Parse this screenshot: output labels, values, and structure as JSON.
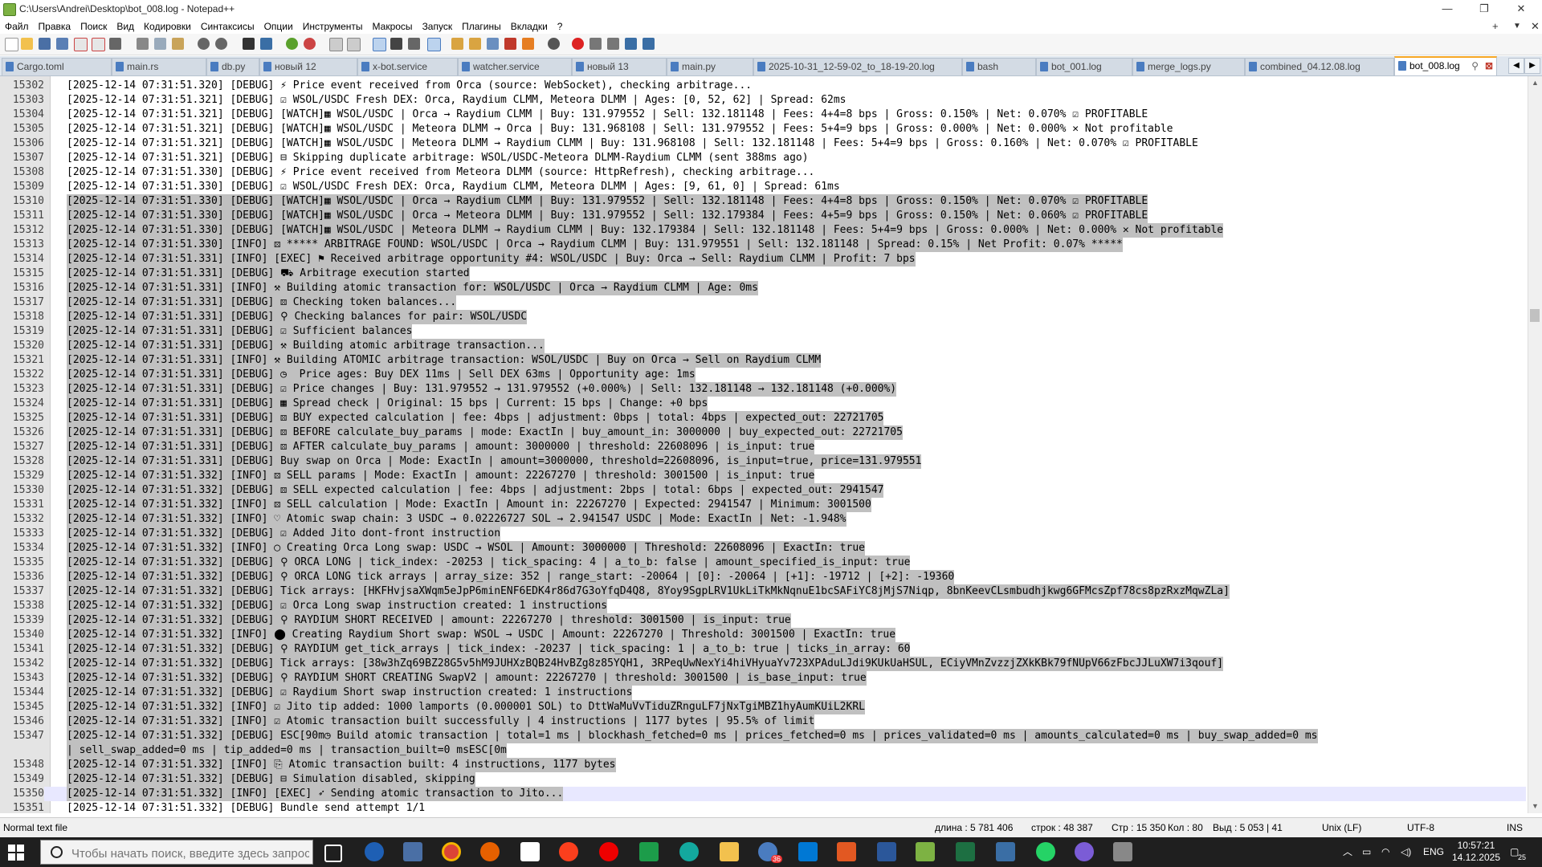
{
  "window": {
    "title": "C:\\Users\\Andrei\\Desktop\\bot_008.log - Notepad++",
    "minimize": "—",
    "maximize": "❐",
    "close": "✕"
  },
  "menu": {
    "items": [
      "Файл",
      "Правка",
      "Поиск",
      "Вид",
      "Кодировки",
      "Синтаксисы",
      "Опции",
      "Инструменты",
      "Макросы",
      "Запуск",
      "Плагины",
      "Вкладки",
      "?"
    ],
    "plus": "+",
    "dropdown": "▼",
    "x": "✕"
  },
  "tabs": [
    {
      "label": "Cargo.toml"
    },
    {
      "label": "main.rs"
    },
    {
      "label": "db.py"
    },
    {
      "label": "новый 12"
    },
    {
      "label": "x-bot.service"
    },
    {
      "label": "watcher.service"
    },
    {
      "label": "новый 13"
    },
    {
      "label": "main.py"
    },
    {
      "label": "2025-10-31_12-59-02_to_18-19-20.log"
    },
    {
      "label": "bash"
    },
    {
      "label": "bot_001.log"
    },
    {
      "label": "merge_logs.py"
    },
    {
      "label": "combined_04.12.08.log"
    },
    {
      "label": "bot_008.log"
    }
  ],
  "tabnav": {
    "left": "◀",
    "right": "▶"
  },
  "lines": [
    {
      "n": "15302",
      "t": "[2025-12-14 07:31:51.320] [DEBUG] ⚡ Price event received from Orca (source: WebSocket), checking arbitrage...",
      "s": false
    },
    {
      "n": "15303",
      "t": "[2025-12-14 07:31:51.321] [DEBUG] ☑ WSOL/USDC Fresh DEX: Orca, Raydium CLMM, Meteora DLMM | Ages: [0, 52, 62] | Spread: 62ms",
      "s": false
    },
    {
      "n": "15304",
      "t": "[2025-12-14 07:31:51.321] [DEBUG] [WATCH]▦ WSOL/USDC | Orca → Raydium CLMM | Buy: 131.979552 | Sell: 132.181148 | Fees: 4+4=8 bps | Gross: 0.150% | Net: 0.070% ☑ PROFITABLE",
      "s": false
    },
    {
      "n": "15305",
      "t": "[2025-12-14 07:31:51.321] [DEBUG] [WATCH]▦ WSOL/USDC | Meteora DLMM → Orca | Buy: 131.968108 | Sell: 131.979552 | Fees: 5+4=9 bps | Gross: 0.000% | Net: 0.000% ✕ Not profitable",
      "s": false
    },
    {
      "n": "15306",
      "t": "[2025-12-14 07:31:51.321] [DEBUG] [WATCH]▦ WSOL/USDC | Meteora DLMM → Raydium CLMM | Buy: 131.968108 | Sell: 132.181148 | Fees: 5+4=9 bps | Gross: 0.160% | Net: 0.070% ☑ PROFITABLE",
      "s": false
    },
    {
      "n": "15307",
      "t": "[2025-12-14 07:31:51.321] [DEBUG] ⊟ Skipping duplicate arbitrage: WSOL/USDC-Meteora DLMM-Raydium CLMM (sent 388ms ago)",
      "s": false
    },
    {
      "n": "15308",
      "t": "[2025-12-14 07:31:51.330] [DEBUG] ⚡ Price event received from Meteora DLMM (source: HttpRefresh), checking arbitrage...",
      "s": false
    },
    {
      "n": "15309",
      "t": "[2025-12-14 07:31:51.330] [DEBUG] ☑ WSOL/USDC Fresh DEX: Orca, Raydium CLMM, Meteora DLMM | Ages: [9, 61, 0] | Spread: 61ms",
      "s": false
    },
    {
      "n": "15310",
      "t": "[2025-12-14 07:31:51.330] [DEBUG] [WATCH]▦ WSOL/USDC | Orca → Raydium CLMM | Buy: 131.979552 | Sell: 132.181148 | Fees: 4+4=8 bps | Gross: 0.150% | Net: 0.070% ☑ PROFITABLE",
      "s": true
    },
    {
      "n": "15311",
      "t": "[2025-12-14 07:31:51.330] [DEBUG] [WATCH]▦ WSOL/USDC | Orca → Meteora DLMM | Buy: 131.979552 | Sell: 132.179384 | Fees: 4+5=9 bps | Gross: 0.150% | Net: 0.060% ☑ PROFITABLE",
      "s": true
    },
    {
      "n": "15312",
      "t": "[2025-12-14 07:31:51.330] [DEBUG] [WATCH]▦ WSOL/USDC | Meteora DLMM → Raydium CLMM | Buy: 132.179384 | Sell: 132.181148 | Fees: 5+4=9 bps | Gross: 0.000% | Net: 0.000% ✕ Not profitable",
      "s": true
    },
    {
      "n": "15313",
      "t": "[2025-12-14 07:31:51.330] [INFO] ⚄ ***** ARBITRAGE FOUND: WSOL/USDC | Orca → Raydium CLMM | Buy: 131.979551 | Sell: 132.181148 | Spread: 0.15% | Net Profit: 0.07% *****",
      "s": true
    },
    {
      "n": "15314",
      "t": "[2025-12-14 07:31:51.331] [INFO] [EXEC] ⚑ Received arbitrage opportunity #4: WSOL/USDC | Buy: Orca → Sell: Raydium CLMM | Profit: 7 bps",
      "s": true
    },
    {
      "n": "15315",
      "t": "[2025-12-14 07:31:51.331] [DEBUG] ⛟ Arbitrage execution started",
      "s": true
    },
    {
      "n": "15316",
      "t": "[2025-12-14 07:31:51.331] [INFO] ⚒ Building atomic transaction for: WSOL/USDC | Orca → Raydium CLMM | Age: 0ms",
      "s": true
    },
    {
      "n": "15317",
      "t": "[2025-12-14 07:31:51.331] [DEBUG] ⚄ Checking token balances...",
      "s": true
    },
    {
      "n": "15318",
      "t": "[2025-12-14 07:31:51.331] [DEBUG] ⚲ Checking balances for pair: WSOL/USDC",
      "s": true
    },
    {
      "n": "15319",
      "t": "[2025-12-14 07:31:51.331] [DEBUG] ☑ Sufficient balances",
      "s": true
    },
    {
      "n": "15320",
      "t": "[2025-12-14 07:31:51.331] [DEBUG] ⚒ Building atomic arbitrage transaction...",
      "s": true
    },
    {
      "n": "15321",
      "t": "[2025-12-14 07:31:51.331] [INFO] ⚒ Building ATOMIC arbitrage transaction: WSOL/USDC | Buy on Orca → Sell on Raydium CLMM",
      "s": true
    },
    {
      "n": "15322",
      "t": "[2025-12-14 07:31:51.331] [DEBUG] ◷  Price ages: Buy DEX 11ms | Sell DEX 63ms | Opportunity age: 1ms",
      "s": true
    },
    {
      "n": "15323",
      "t": "[2025-12-14 07:31:51.331] [DEBUG] ☑ Price changes | Buy: 131.979552 → 131.979552 (+0.000%) | Sell: 132.181148 → 132.181148 (+0.000%)",
      "s": true
    },
    {
      "n": "15324",
      "t": "[2025-12-14 07:31:51.331] [DEBUG] ▦ Spread check | Original: 15 bps | Current: 15 bps | Change: +0 bps",
      "s": true
    },
    {
      "n": "15325",
      "t": "[2025-12-14 07:31:51.331] [DEBUG] ⚄ BUY expected calculation | fee: 4bps | adjustment: 0bps | total: 4bps | expected_out: 22721705",
      "s": true
    },
    {
      "n": "15326",
      "t": "[2025-12-14 07:31:51.331] [DEBUG] ⚄ BEFORE calculate_buy_params | mode: ExactIn | buy_amount_in: 3000000 | buy_expected_out: 22721705",
      "s": true
    },
    {
      "n": "15327",
      "t": "[2025-12-14 07:31:51.331] [DEBUG] ⚄ AFTER calculate_buy_params | amount: 3000000 | threshold: 22608096 | is_input: true",
      "s": true
    },
    {
      "n": "15328",
      "t": "[2025-12-14 07:31:51.331] [DEBUG] Buy swap on Orca | Mode: ExactIn | amount=3000000, threshold=22608096, is_input=true, price=131.979551",
      "s": true
    },
    {
      "n": "15329",
      "t": "[2025-12-14 07:31:51.332] [INFO] ⚄ SELL params | Mode: ExactIn | amount: 22267270 | threshold: 3001500 | is_input: true",
      "s": true
    },
    {
      "n": "15330",
      "t": "[2025-12-14 07:31:51.332] [DEBUG] ⚄ SELL expected calculation | fee: 4bps | adjustment: 2bps | total: 6bps | expected_out: 2941547",
      "s": true
    },
    {
      "n": "15331",
      "t": "[2025-12-14 07:31:51.332] [INFO] ⚄ SELL calculation | Mode: ExactIn | Amount in: 22267270 | Expected: 2941547 | Minimum: 3001500",
      "s": true
    },
    {
      "n": "15332",
      "t": "[2025-12-14 07:31:51.332] [INFO] ♡ Atomic swap chain: 3 USDC → 0.02226727 SOL → 2.941547 USDC | Mode: ExactIn | Net: -1.948%",
      "s": true
    },
    {
      "n": "15333",
      "t": "[2025-12-14 07:31:51.332] [DEBUG] ☑ Added Jito dont-front instruction",
      "s": true
    },
    {
      "n": "15334",
      "t": "[2025-12-14 07:31:51.332] [INFO] ◯ Creating Orca Long swap: USDC → WSOL | Amount: 3000000 | Threshold: 22608096 | ExactIn: true",
      "s": true
    },
    {
      "n": "15335",
      "t": "[2025-12-14 07:31:51.332] [DEBUG] ⚲ ORCA LONG | tick_index: -20253 | tick_spacing: 4 | a_to_b: false | amount_specified_is_input: true",
      "s": true
    },
    {
      "n": "15336",
      "t": "[2025-12-14 07:31:51.332] [DEBUG] ⚲ ORCA LONG tick arrays | array_size: 352 | range_start: -20064 | [0]: -20064 | [+1]: -19712 | [+2]: -19360",
      "s": true
    },
    {
      "n": "15337",
      "t": "[2025-12-14 07:31:51.332] [DEBUG] Tick arrays: [HKFHvjsaXWqm5eJpP6minENF6EDK4r86d7G3oYfqD4Q8, 8Yoy9SgpLRV1UkLiTkMkNqnuE1bcSAFiYC8jMjS7Niqp, 8bnKeevCLsmbudhjkwg6GFMcsZpf78cs8pzRxzMqwZLa]",
      "s": true
    },
    {
      "n": "15338",
      "t": "[2025-12-14 07:31:51.332] [DEBUG] ☑ Orca Long swap instruction created: 1 instructions",
      "s": true
    },
    {
      "n": "15339",
      "t": "[2025-12-14 07:31:51.332] [DEBUG] ⚲ RAYDIUM SHORT RECEIVED | amount: 22267270 | threshold: 3001500 | is_input: true",
      "s": true
    },
    {
      "n": "15340",
      "t": "[2025-12-14 07:31:51.332] [INFO] ⬤ Creating Raydium Short swap: WSOL → USDC | Amount: 22267270 | Threshold: 3001500 | ExactIn: true",
      "s": true
    },
    {
      "n": "15341",
      "t": "[2025-12-14 07:31:51.332] [DEBUG] ⚲ RAYDIUM get_tick_arrays | tick_index: -20237 | tick_spacing: 1 | a_to_b: true | ticks_in_array: 60",
      "s": true
    },
    {
      "n": "15342",
      "t": "[2025-12-14 07:31:51.332] [DEBUG] Tick arrays: [38w3hZq69BZ28G5v5hM9JUHXzBQB24HvBZg8z85YQH1, 3RPeqUwNexYi4hiVHyuaYv723XPAduLJdi9KUkUaHSUL, ECiyVMnZvzzjZXkKBk79fNUpV66zFbcJJLuXW7i3qouf]",
      "s": true
    },
    {
      "n": "15343",
      "t": "[2025-12-14 07:31:51.332] [DEBUG] ⚲ RAYDIUM SHORT CREATING SwapV2 | amount: 22267270 | threshold: 3001500 | is_base_input: true",
      "s": true
    },
    {
      "n": "15344",
      "t": "[2025-12-14 07:31:51.332] [DEBUG] ☑ Raydium Short swap instruction created: 1 instructions",
      "s": true
    },
    {
      "n": "15345",
      "t": "[2025-12-14 07:31:51.332] [INFO] ☑ Jito tip added: 1000 lamports (0.000001 SOL) to DttWaMuVvTiduZRnguLF7jNxTgiMBZ1hyAumKUiL2KRL",
      "s": true
    },
    {
      "n": "15346",
      "t": "[2025-12-14 07:31:51.332] [INFO] ☑ Atomic transaction built successfully | 4 instructions | 1177 bytes | 95.5% of limit",
      "s": true
    },
    {
      "n": "15347",
      "t": "[2025-12-14 07:31:51.332] [DEBUG] ESC[90m◷ Build atomic transaction | total=1 ms | blockhash_fetched=0 ms | prices_fetched=0 ms | prices_validated=0 ms | amounts_calculated=0 ms | buy_swap_added=0 ms",
      "s": true
    },
    {
      "n": "",
      "t": "| sell_swap_added=0 ms | tip_added=0 ms | transaction_built=0 msESC[0m",
      "s": true
    },
    {
      "n": "15348",
      "t": "[2025-12-14 07:31:51.332] [INFO] ⎘ Atomic transaction built: 4 instructions, 1177 bytes",
      "s": true
    },
    {
      "n": "15349",
      "t": "[2025-12-14 07:31:51.332] [DEBUG] ⊟ Simulation disabled, skipping",
      "s": true
    },
    {
      "n": "15350",
      "t": "[2025-12-14 07:31:51.332] [INFO] [EXEC] ➶ Sending atomic transaction to Jito...",
      "s": true,
      "cur": true
    },
    {
      "n": "15351",
      "t": "[2025-12-14 07:31:51.332] [DEBUG] Bundle send attempt 1/1",
      "s": false
    }
  ],
  "status": {
    "type": "Normal text file",
    "length": "длина : 5 781 406",
    "lines": "строк : 48 387",
    "pos": "Стр : 15 350",
    "col": "Кол : 80",
    "sel": "Выд : 5 053 | 41",
    "eol": "Unix (LF)",
    "enc": "UTF-8",
    "ins": "INS"
  },
  "taskbar": {
    "search_placeholder": "Чтобы начать поиск, введите здесь запрос",
    "lang": "ENG",
    "time": "10:57:21",
    "date": "14.12.2025",
    "notif": "25",
    "badge_chrome": "36"
  },
  "colors": {
    "tab_active_accent": "#f5a623",
    "selection": "#c0c0c0",
    "gutter": "#e4e4e4",
    "taskbar": "#1f1f1f"
  }
}
